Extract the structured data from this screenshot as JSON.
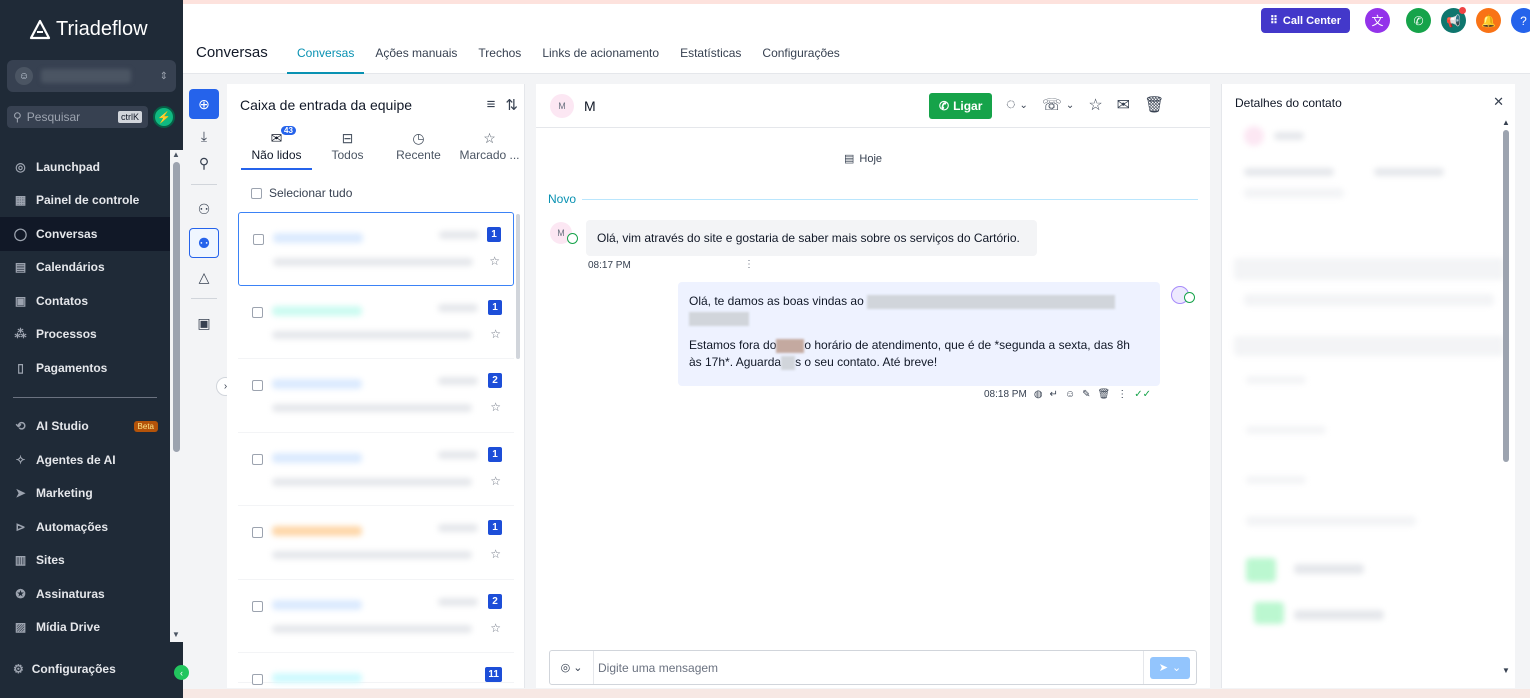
{
  "brand": {
    "name": "Triadeflow"
  },
  "sidebar": {
    "search_placeholder": "Pesquisar",
    "search_shortcut": "ctrlK",
    "items": [
      {
        "label": "Launchpad",
        "icon": "rocket-icon"
      },
      {
        "label": "Painel de controle",
        "icon": "grid-icon"
      },
      {
        "label": "Conversas",
        "icon": "chat-bubble-icon"
      },
      {
        "label": "Calendários",
        "icon": "calendar-icon"
      },
      {
        "label": "Contatos",
        "icon": "contacts-icon"
      },
      {
        "label": "Processos",
        "icon": "pipeline-icon"
      },
      {
        "label": "Pagamentos",
        "icon": "receipt-icon"
      }
    ],
    "items2": [
      {
        "label": "AI Studio",
        "icon": "ai-studio-icon",
        "badge": "Beta"
      },
      {
        "label": "Agentes de AI",
        "icon": "sparkle-icon"
      },
      {
        "label": "Marketing",
        "icon": "send-icon"
      },
      {
        "label": "Automações",
        "icon": "automation-icon"
      },
      {
        "label": "Sites",
        "icon": "sites-icon"
      },
      {
        "label": "Assinaturas",
        "icon": "award-icon"
      },
      {
        "label": "Mídia Drive",
        "icon": "image-icon"
      }
    ],
    "settings_label": "Configurações"
  },
  "header": {
    "title": "Conversas",
    "tabs": [
      "Conversas",
      "Ações manuais",
      "Trechos",
      "Links de acionamento",
      "Estatísticas",
      "Configurações"
    ],
    "call_center_label": "Call Center"
  },
  "inbox": {
    "title": "Caixa de entrada da equipe",
    "tabs": [
      {
        "label": "Não lidos",
        "count": "43"
      },
      {
        "label": "Todos"
      },
      {
        "label": "Recente"
      },
      {
        "label": "Marcado ..."
      }
    ],
    "select_all_label": "Selecionar tudo",
    "conversations": [
      {
        "unread": "1"
      },
      {
        "unread": "1"
      },
      {
        "unread": "2"
      },
      {
        "unread": "1"
      },
      {
        "unread": "1"
      },
      {
        "unread": "2"
      },
      {
        "unread": "11"
      }
    ]
  },
  "chat": {
    "contact_initial": "M",
    "contact_name": "M",
    "call_label": "Ligar",
    "date_label": "Hoje",
    "new_divider": "Novo",
    "incoming_text": "Olá, vim através do site e gostaria de saber mais sobre os serviços do Cartório.",
    "incoming_time": "08:17 PM",
    "outgoing_line1": "Olá, te damos as boas vindas ao",
    "outgoing_line2a": "Estamos fora do",
    "outgoing_line2b": "o horário de atendimento, que é de *segunda a sexta, das 8h",
    "outgoing_line3a": "às 17h*. Aguarda",
    "outgoing_line3b": "s o seu contato. Até breve!",
    "outgoing_time": "08:18 PM",
    "composer_placeholder": "Digite uma mensagem"
  },
  "details": {
    "title": "Detalhes do contato"
  },
  "colors": {
    "sidebar_bg": "#1f2a37",
    "accent": "#0891b2",
    "primary": "#2563eb",
    "call_green": "#16a34a"
  }
}
